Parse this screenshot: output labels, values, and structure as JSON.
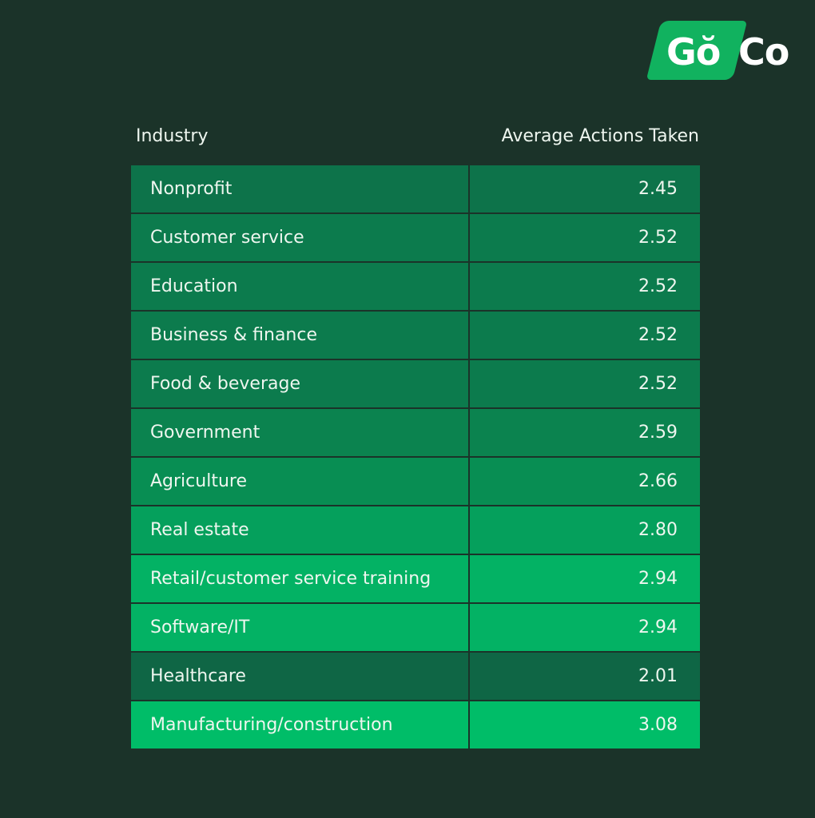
{
  "logo": {
    "text_go": "Gŏ",
    "text_co": "Co"
  },
  "header": {
    "industry": "Industry",
    "value": "Average Actions Taken"
  },
  "chart_data": {
    "type": "table",
    "title": "",
    "columns": [
      "Industry",
      "Average Actions Taken"
    ],
    "rows": [
      {
        "industry": "Nonprofit",
        "value": "2.45",
        "color": "#0d734a"
      },
      {
        "industry": "Customer service",
        "value": "2.52",
        "color": "#0c7b4d"
      },
      {
        "industry": "Education",
        "value": "2.52",
        "color": "#0c7b4d"
      },
      {
        "industry": "Business & finance",
        "value": "2.52",
        "color": "#0c7b4d"
      },
      {
        "industry": "Food & beverage",
        "value": "2.52",
        "color": "#0c7b4d"
      },
      {
        "industry": "Government",
        "value": "2.59",
        "color": "#0b834f"
      },
      {
        "industry": "Agriculture",
        "value": "2.66",
        "color": "#088e53"
      },
      {
        "industry": "Real estate",
        "value": "2.80",
        "color": "#05a05c"
      },
      {
        "industry": "Retail/customer service training",
        "value": "2.94",
        "color": "#03b264"
      },
      {
        "industry": "Software/IT",
        "value": "2.94",
        "color": "#03b264"
      },
      {
        "industry": "Healthcare",
        "value": "2.01",
        "color": "#0f6645"
      },
      {
        "industry": "Manufacturing/construction",
        "value": "3.08",
        "color": "#00bd68"
      }
    ]
  }
}
